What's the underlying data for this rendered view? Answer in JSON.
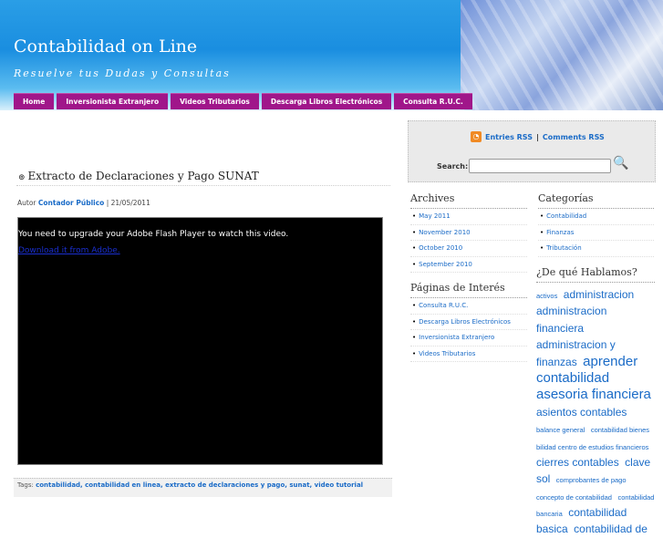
{
  "header": {
    "title": "Contabilidad on Line",
    "tagline": "Resuelve tus Dudas y Consultas"
  },
  "nav": [
    "Home",
    "Inversionista Extranjero",
    "Videos Tributarios",
    "Descarga Libros Electrónicos",
    "Consulta R.U.C."
  ],
  "post": {
    "title": "Extracto de Declaraciones y Pago SUNAT",
    "author_label": "Autor",
    "author": "Contador Público",
    "date": "| 21/05/2011",
    "flash_msg": "You need to upgrade your Adobe Flash Player to watch this video.",
    "flash_link": "Download it from Adobe.",
    "tags_label": "Tags:",
    "tags": "contabilidad, contabilidad en linea, extracto de declaraciones y pago, sunat, video tutorial"
  },
  "sidebar": {
    "entries_rss": "Entries RSS",
    "sep": "|",
    "comments_rss": "Comments RSS",
    "search_label": "Search:",
    "archives": {
      "title": "Archives",
      "items": [
        "May 2011",
        "November 2010",
        "October 2010",
        "September 2010"
      ]
    },
    "paginas": {
      "title": "Páginas de Interés",
      "items": [
        "Consulta R.U.C.",
        "Descarga Libros Electrónicos",
        "Inversionista Extranjero",
        "Videos Tributarios"
      ]
    },
    "categorias": {
      "title": "Categorías",
      "items": [
        "Contabilidad",
        "Finanzas",
        "Tributación"
      ]
    },
    "hablamos": {
      "title": "¿De qué Hablamos?",
      "tags": [
        {
          "t": "activos",
          "s": 1
        },
        {
          "t": "administracion",
          "s": 2
        },
        {
          "t": "administracion financiera",
          "s": 2
        },
        {
          "t": "administracion y finanzas",
          "s": 2
        },
        {
          "t": "aprender",
          "s": 3
        },
        {
          "t": "contabilidad",
          "s": 3
        },
        {
          "t": "asesoria financiera",
          "s": 3
        },
        {
          "t": "asientos contables",
          "s": 2
        },
        {
          "t": "balance general",
          "s": 1
        },
        {
          "t": "contabilidad bienes",
          "s": 1
        },
        {
          "t": "bilidad centro de estudios financieros",
          "s": 1
        },
        {
          "t": "cierres contables",
          "s": 2
        },
        {
          "t": "clave sol",
          "s": 2
        },
        {
          "t": "comprobantes de pago",
          "s": 1
        },
        {
          "t": "concepto de contabilidad",
          "s": 1
        },
        {
          "t": "contabilidad bancaria",
          "s": 1
        },
        {
          "t": "contabilidad basica",
          "s": 2
        },
        {
          "t": "contabilidad de",
          "s": 2
        }
      ]
    }
  }
}
